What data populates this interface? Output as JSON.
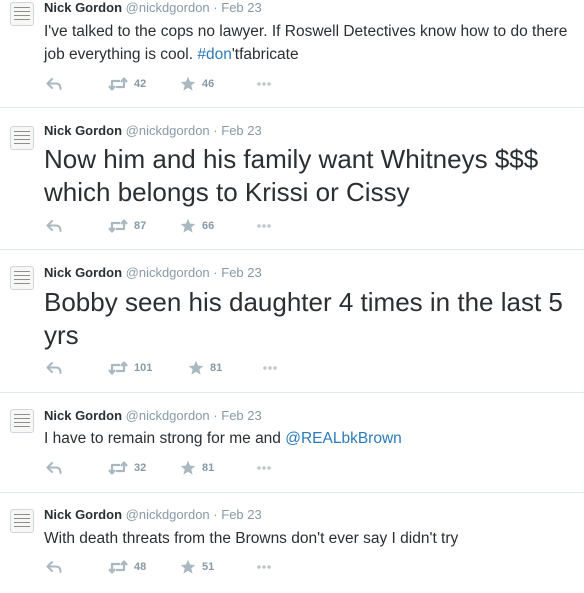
{
  "tweets": [
    {
      "name": "Nick Gordon",
      "handle": "@nickdgordon",
      "separator": "·",
      "date": "Feb 23",
      "text_before": "I've talked to the cops no lawyer. If Roswell Detectives know how to do there job everything is cool. ",
      "hashtag": "#don",
      "text_after": "'tfabricate",
      "retweets": "42",
      "favorites": "46"
    },
    {
      "name": "Nick Gordon",
      "handle": "@nickdgordon",
      "separator": "·",
      "date": "Feb 23",
      "text": "Now him and his family want Whitneys $$$ which belongs to Krissi or Cissy",
      "retweets": "87",
      "favorites": "66"
    },
    {
      "name": "Nick Gordon",
      "handle": "@nickdgordon",
      "separator": "·",
      "date": "Feb 23",
      "text": "Bobby seen his daughter 4 times in the last 5 yrs",
      "retweets": "101",
      "favorites": "81"
    },
    {
      "name": "Nick Gordon",
      "handle": "@nickdgordon",
      "separator": "·",
      "date": "Feb 23",
      "text_before": "I have to remain strong for me and ",
      "mention": "@REALbkBrown",
      "retweets": "32",
      "favorites": "81"
    },
    {
      "name": "Nick Gordon",
      "handle": "@nickdgordon",
      "separator": "·",
      "date": "Feb 23",
      "text": "With death threats from the Browns don't ever say I didn't try",
      "retweets": "48",
      "favorites": "51"
    }
  ],
  "icons": {
    "reply": "reply-icon",
    "retweet": "retweet-icon",
    "favorite": "star-icon",
    "more": "more-icon"
  },
  "colors": {
    "link": "#2b7bb9",
    "text": "#292f33",
    "muted": "#8899a6",
    "icon": "#aab8c2",
    "divider": "#e1e8ed"
  }
}
